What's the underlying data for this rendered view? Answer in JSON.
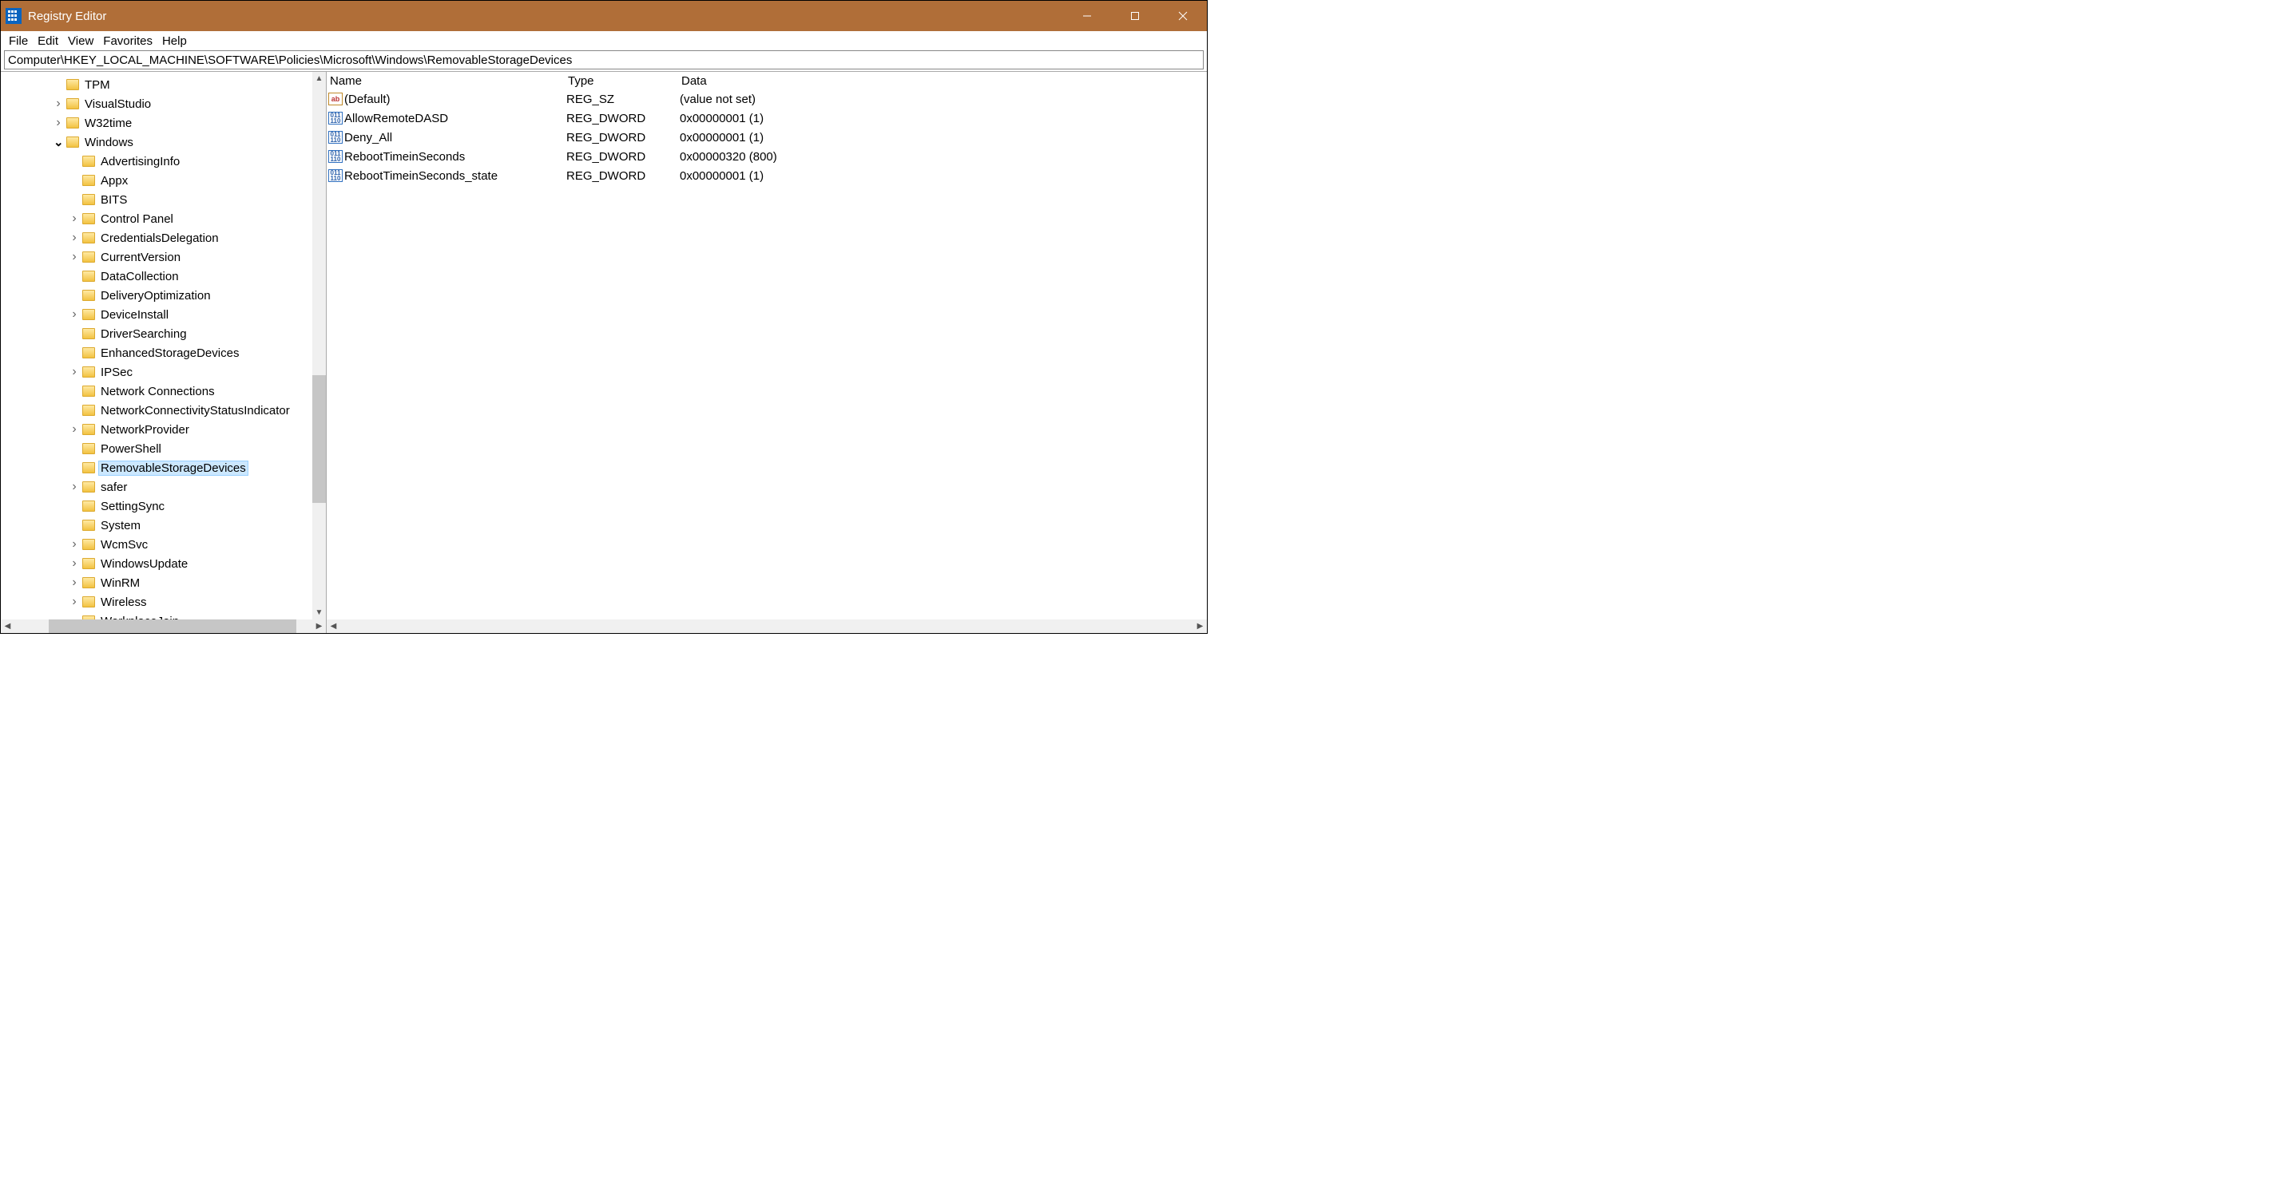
{
  "titlebar": {
    "title": "Registry Editor"
  },
  "menu": {
    "file": "File",
    "edit": "Edit",
    "view": "View",
    "favorites": "Favorites",
    "help": "Help"
  },
  "address": "Computer\\HKEY_LOCAL_MACHINE\\SOFTWARE\\Policies\\Microsoft\\Windows\\RemovableStorageDevices",
  "tree": {
    "items": [
      {
        "indent": 3,
        "chevron": "",
        "label": "TPM"
      },
      {
        "indent": 3,
        "chevron": ">",
        "label": "VisualStudio"
      },
      {
        "indent": 3,
        "chevron": ">",
        "label": "W32time"
      },
      {
        "indent": 3,
        "chevron": "v",
        "label": "Windows"
      },
      {
        "indent": 4,
        "chevron": "",
        "label": "AdvertisingInfo"
      },
      {
        "indent": 4,
        "chevron": "",
        "label": "Appx"
      },
      {
        "indent": 4,
        "chevron": "",
        "label": "BITS"
      },
      {
        "indent": 4,
        "chevron": ">",
        "label": "Control Panel"
      },
      {
        "indent": 4,
        "chevron": ">",
        "label": "CredentialsDelegation"
      },
      {
        "indent": 4,
        "chevron": ">",
        "label": "CurrentVersion"
      },
      {
        "indent": 4,
        "chevron": "",
        "label": "DataCollection"
      },
      {
        "indent": 4,
        "chevron": "",
        "label": "DeliveryOptimization"
      },
      {
        "indent": 4,
        "chevron": ">",
        "label": "DeviceInstall"
      },
      {
        "indent": 4,
        "chevron": "",
        "label": "DriverSearching"
      },
      {
        "indent": 4,
        "chevron": "",
        "label": "EnhancedStorageDevices"
      },
      {
        "indent": 4,
        "chevron": ">",
        "label": "IPSec"
      },
      {
        "indent": 4,
        "chevron": "",
        "label": "Network Connections"
      },
      {
        "indent": 4,
        "chevron": "",
        "label": "NetworkConnectivityStatusIndicator"
      },
      {
        "indent": 4,
        "chevron": ">",
        "label": "NetworkProvider"
      },
      {
        "indent": 4,
        "chevron": "",
        "label": "PowerShell"
      },
      {
        "indent": 4,
        "chevron": "",
        "label": "RemovableStorageDevices",
        "selected": true
      },
      {
        "indent": 4,
        "chevron": ">",
        "label": "safer"
      },
      {
        "indent": 4,
        "chevron": "",
        "label": "SettingSync"
      },
      {
        "indent": 4,
        "chevron": "",
        "label": "System"
      },
      {
        "indent": 4,
        "chevron": ">",
        "label": "WcmSvc"
      },
      {
        "indent": 4,
        "chevron": ">",
        "label": "WindowsUpdate"
      },
      {
        "indent": 4,
        "chevron": ">",
        "label": "WinRM"
      },
      {
        "indent": 4,
        "chevron": ">",
        "label": "Wireless"
      },
      {
        "indent": 4,
        "chevron": "",
        "label": "WorkplaceJoin"
      }
    ]
  },
  "list": {
    "headers": {
      "name": "Name",
      "type": "Type",
      "data": "Data"
    },
    "rows": [
      {
        "icon": "sz",
        "name": "(Default)",
        "type": "REG_SZ",
        "data": "(value not set)"
      },
      {
        "icon": "dw",
        "name": "AllowRemoteDASD",
        "type": "REG_DWORD",
        "data": "0x00000001 (1)"
      },
      {
        "icon": "dw",
        "name": "Deny_All",
        "type": "REG_DWORD",
        "data": "0x00000001 (1)"
      },
      {
        "icon": "dw",
        "name": "RebootTimeinSeconds",
        "type": "REG_DWORD",
        "data": "0x00000320 (800)"
      },
      {
        "icon": "dw",
        "name": "RebootTimeinSeconds_state",
        "type": "REG_DWORD",
        "data": "0x00000001 (1)"
      }
    ]
  }
}
